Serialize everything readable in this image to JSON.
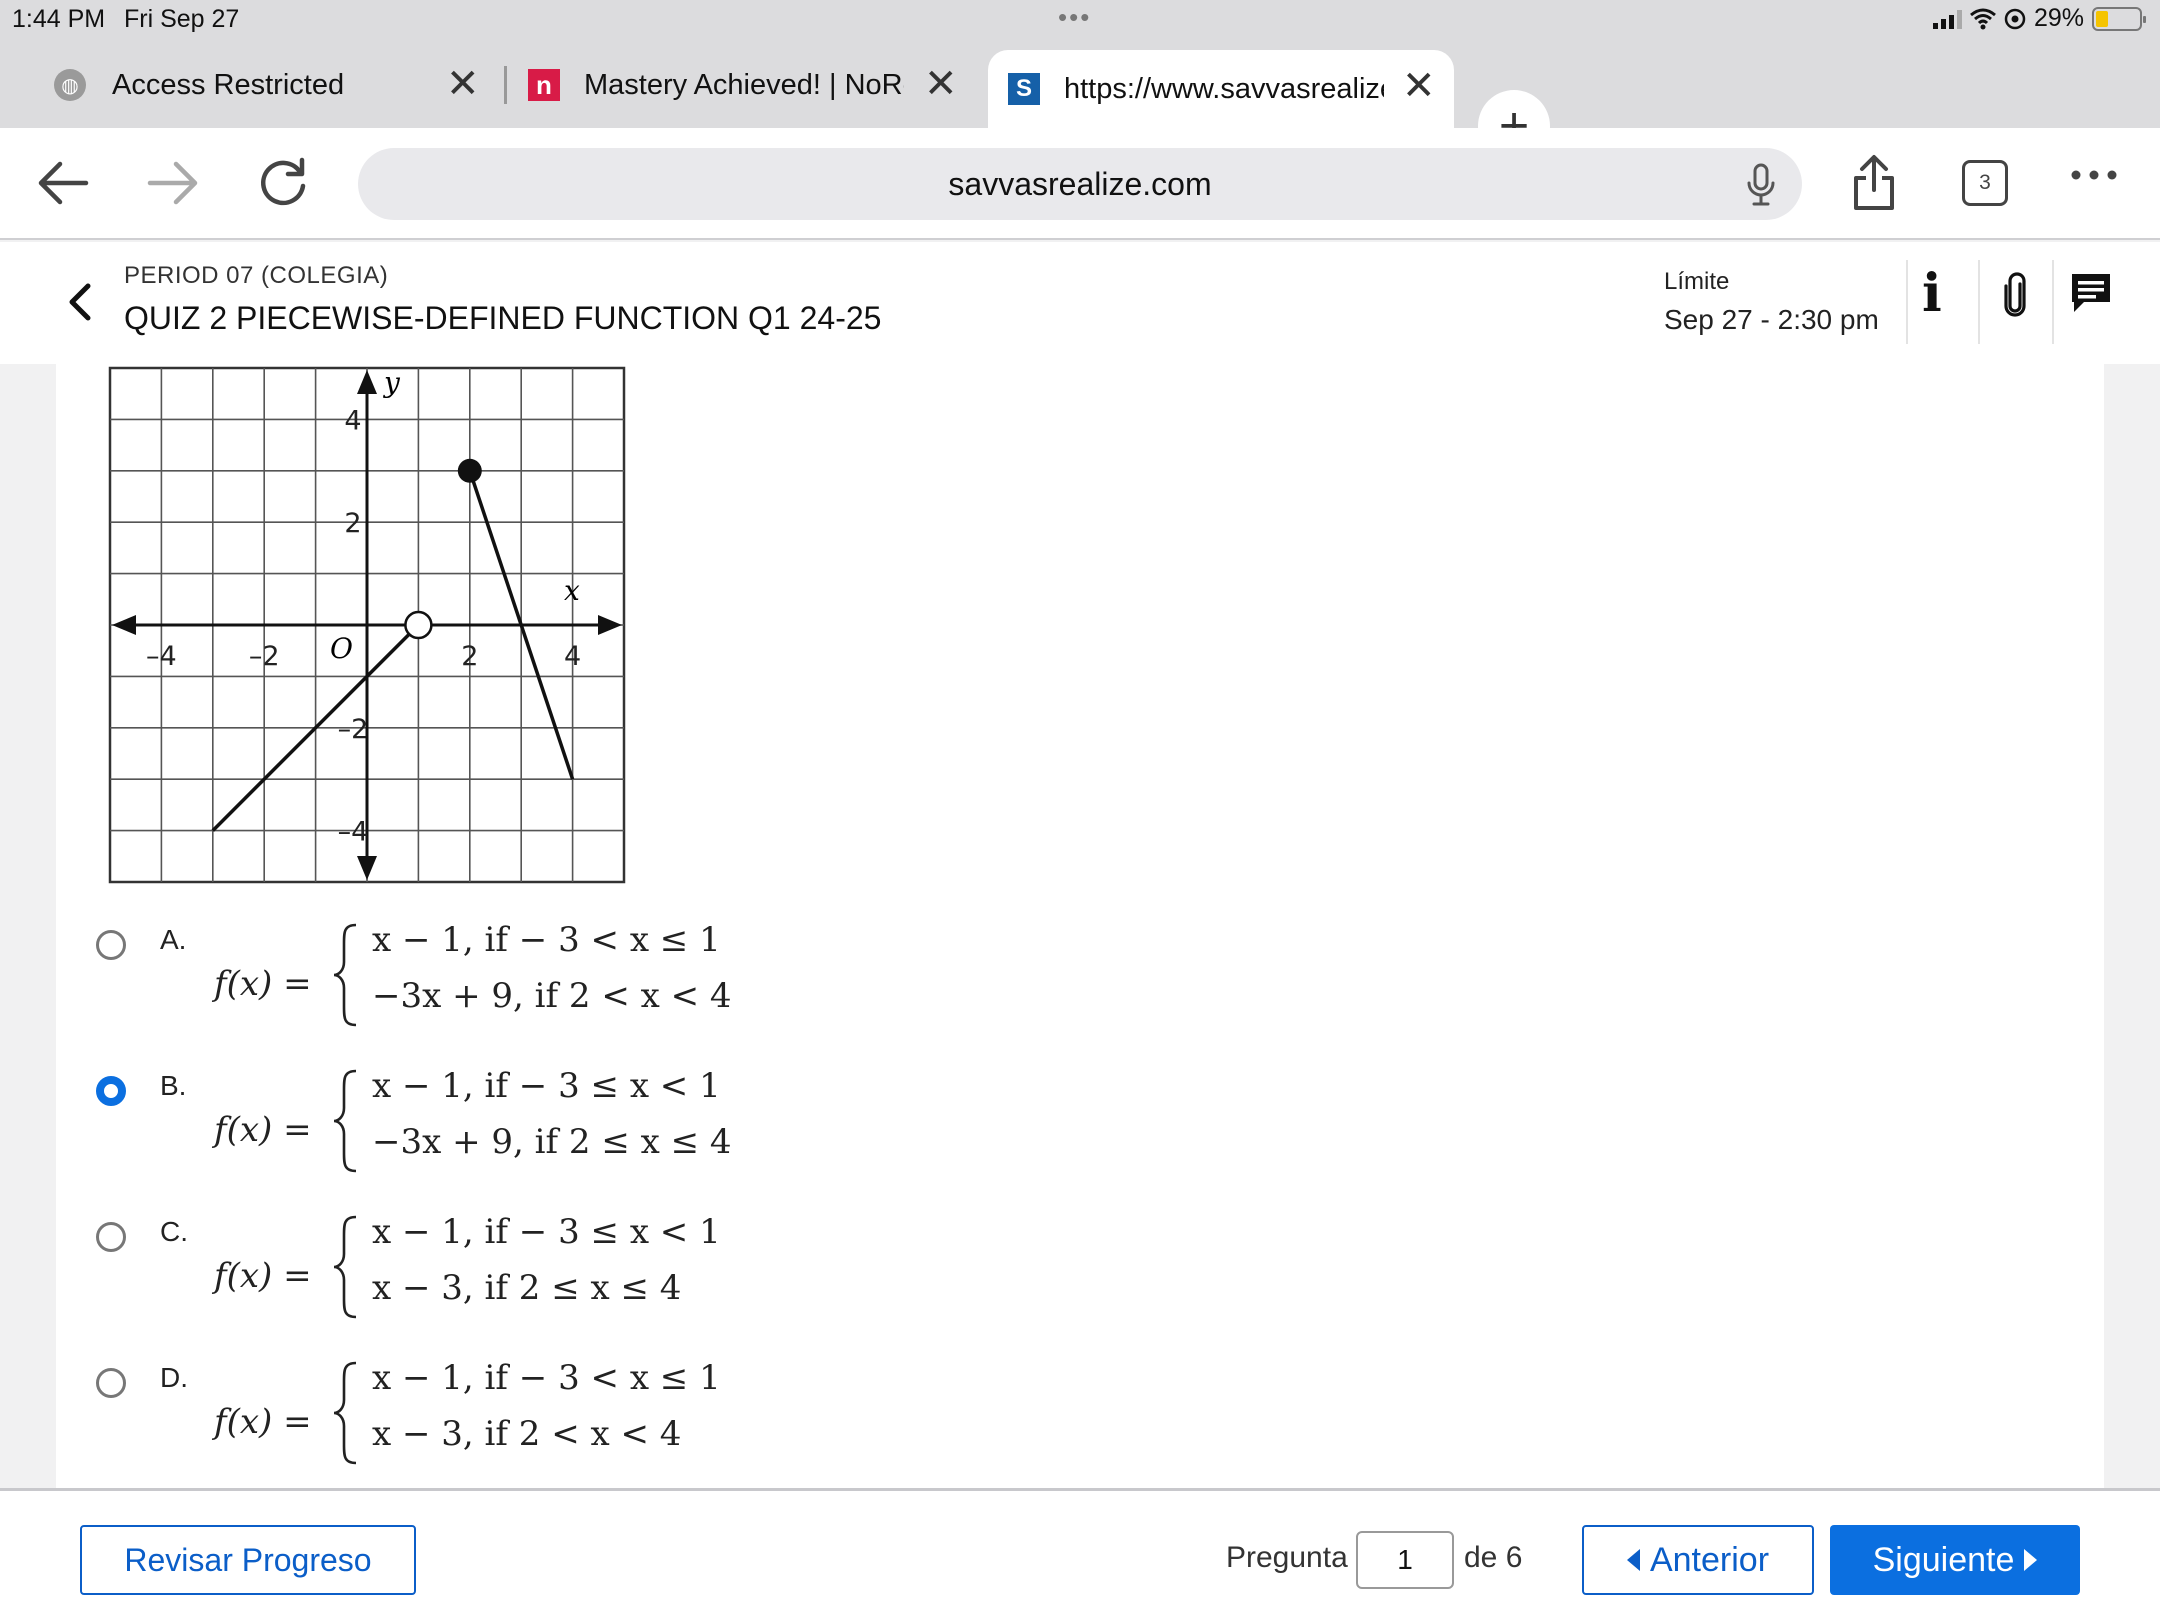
{
  "status_bar": {
    "time": "1:44 PM",
    "date": "Fri Sep 27",
    "battery": "29%",
    "battery_level": 0.29
  },
  "tabs": [
    {
      "title": "Access Restricted",
      "icon": "globe-icon",
      "active": false
    },
    {
      "title": "Mastery Achieved! | NoRedInk",
      "icon": "noredink-icon",
      "active": false
    },
    {
      "title": "https://www.savvasrealize.com",
      "icon": "savvas-icon",
      "active": true
    }
  ],
  "toolbar": {
    "url": "savvasrealize.com",
    "tab_count": "3"
  },
  "header": {
    "course": "PERIOD 07 (COLEGIA)",
    "title": "QUIZ 2 PIECEWISE-DEFINED FUNCTION Q1 24-25",
    "limit_label": "Límite",
    "limit_date": "Sep 27 - 2:30 pm"
  },
  "graph": {
    "x_label": "x",
    "y_label": "y",
    "origin_label": "O",
    "x_ticks": [
      "–4",
      "–2",
      "2",
      "4"
    ],
    "y_ticks": [
      "4",
      "2",
      "–2",
      "–4"
    ],
    "range": [
      -5,
      5
    ],
    "segments": [
      {
        "from": [
          -3,
          -4
        ],
        "to": [
          1,
          0
        ],
        "start_closed": true,
        "end_open_circle": true
      },
      {
        "from": [
          2,
          3
        ],
        "to": [
          4,
          -3
        ],
        "start_filled_circle": true
      }
    ]
  },
  "choices": [
    {
      "letter": "A.",
      "fx": "f(x) =",
      "case1": "x − 1, if  − 3 < x ≤ 1",
      "case2": "−3x + 9,  if 2 < x < 4",
      "selected": false
    },
    {
      "letter": "B.",
      "fx": "f(x) =",
      "case1": "x − 1, if  − 3 ≤ x < 1",
      "case2": "−3x + 9,  if 2 ≤ x ≤ 4",
      "selected": true
    },
    {
      "letter": "C.",
      "fx": "f(x) =",
      "case1": "x − 1, if  − 3 ≤ x < 1",
      "case2": "x − 3,  if 2 ≤ x ≤ 4",
      "selected": false
    },
    {
      "letter": "D.",
      "fx": "f(x) =",
      "case1": "x − 1, if  − 3 < x ≤ 1",
      "case2": "x − 3,  if 2 < x < 4",
      "selected": false
    }
  ],
  "footer": {
    "review": "Revisar Progreso",
    "question_label": "Pregunta",
    "question_value": "1",
    "question_total": "de 6",
    "prev": "Anterior",
    "next": "Siguiente"
  },
  "colors": {
    "accent": "#0b6fe0",
    "accent_dark": "#0b5ec8",
    "noredink": "#d81b47",
    "savvas": "#1560a8"
  }
}
